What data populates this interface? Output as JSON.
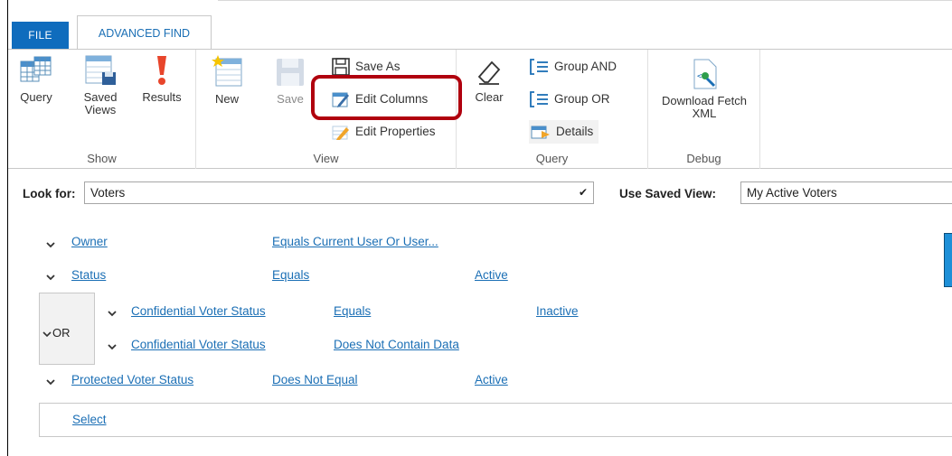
{
  "tabs": {
    "file": "FILE",
    "advanced_find": "ADVANCED FIND"
  },
  "ribbon": {
    "show": {
      "label": "Show",
      "query": "Query",
      "saved_views_1": "Saved",
      "saved_views_2": "Views",
      "results": "Results"
    },
    "view": {
      "label": "View",
      "new": "New",
      "save": "Save",
      "save_as": "Save As",
      "edit_columns": "Edit Columns",
      "edit_properties": "Edit Properties"
    },
    "query": {
      "label": "Query",
      "clear": "Clear",
      "group_and": "Group AND",
      "group_or": "Group OR",
      "details": "Details"
    },
    "debug": {
      "label": "Debug",
      "download_1": "Download Fetch",
      "download_2": "XML"
    }
  },
  "look_for": {
    "label": "Look for:",
    "value": "Voters"
  },
  "saved_view": {
    "label": "Use Saved View:",
    "value": "My Active Voters"
  },
  "criteria": {
    "row1": {
      "field": "Owner",
      "operator": "Equals Current User Or User..."
    },
    "row2": {
      "field": "Status",
      "operator": "Equals",
      "value": "Active"
    },
    "or_label": "OR",
    "row3": {
      "field": "Confidential Voter Status",
      "operator": "Equals",
      "value": "Inactive"
    },
    "row4": {
      "field": "Confidential Voter Status",
      "operator": "Does Not Contain Data"
    },
    "row5": {
      "field": "Protected Voter Status",
      "operator": "Does Not Equal",
      "value": "Active"
    },
    "select": "Select"
  },
  "colors": {
    "accent": "#1b6fb5",
    "file_tab": "#0f6cbd",
    "highlight": "#b0000e"
  }
}
